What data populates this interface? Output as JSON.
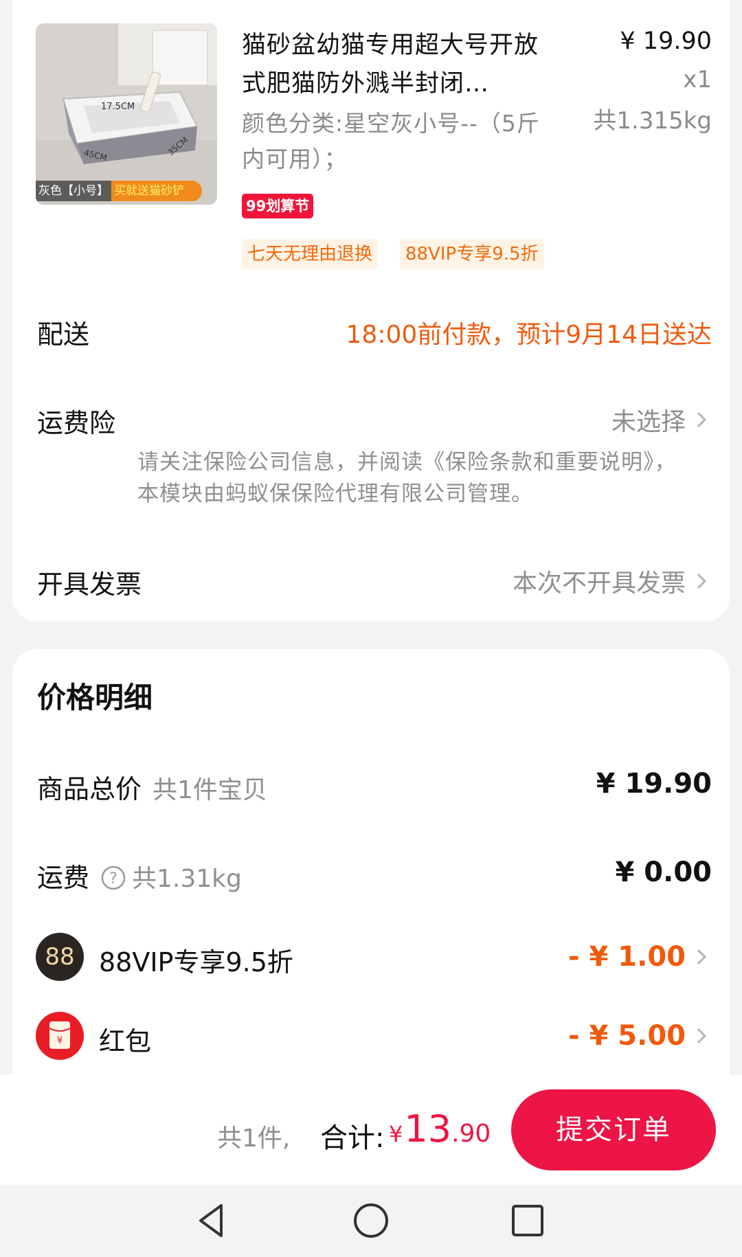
{
  "product": {
    "title": "猫砂盆幼猫专用超大号开放式肥猫防外溅半封闭…",
    "spec": "颜色分类:星空灰小号--（5斤内可用）；",
    "price": "¥ 19.90",
    "quantity": "x1",
    "weight": "共1.315kg",
    "promo_badge": "99划算节",
    "tags": [
      "七天无理由退换",
      "88VIP专享9.5折"
    ],
    "image": {
      "strip_left": "灰色【小号】",
      "strip_right": "买就送猫砂铲",
      "dims": [
        "17.5CM",
        "45CM",
        "35CM"
      ]
    }
  },
  "delivery": {
    "label": "配送",
    "value": "18:00前付款，预计9月14日送达"
  },
  "shipping_insurance": {
    "label": "运费险",
    "value": "未选择",
    "note": "请关注保险公司信息，并阅读《保险条款和重要说明》，本模块由蚂蚁保保险代理有限公司管理。"
  },
  "invoice": {
    "label": "开具发票",
    "value": "本次不开具发票"
  },
  "price_details": {
    "title": "价格明细",
    "goods_total_label": "商品总价",
    "goods_total_sub": "共1件宝贝",
    "goods_total_value": "¥ 19.90",
    "freight_label": "运费",
    "freight_sub": "共1.31kg",
    "freight_value": "¥ 0.00",
    "vip_label": "88VIP专享9.5折",
    "vip_icon_text": "88",
    "vip_value": "- ¥ 1.00",
    "hongbao_label": "红包",
    "hongbao_value": "- ¥ 5.00"
  },
  "bottom": {
    "count": "共1件,",
    "total_label": "合计:",
    "yen": "¥",
    "total_int": "13",
    "total_dec": ".90",
    "submit_label": "提交订单"
  },
  "colors": {
    "accent_red": "#ed1446",
    "accent_orange": "#f15a0c",
    "text_gray": "#8f8f8f"
  },
  "icons": [
    "help-icon",
    "chevron-right-icon",
    "vip-88-icon",
    "hongbao-icon",
    "nav-back-icon",
    "nav-home-icon",
    "nav-recents-icon"
  ]
}
